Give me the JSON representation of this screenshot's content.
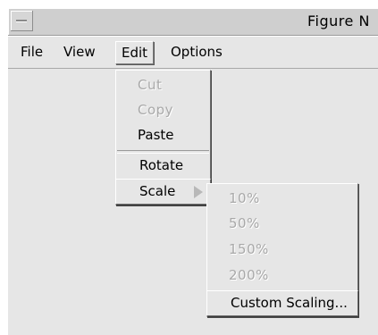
{
  "window": {
    "title": "Figure N"
  },
  "menubar": {
    "items": [
      {
        "label": "File"
      },
      {
        "label": "View"
      },
      {
        "label": "Edit"
      },
      {
        "label": "Options"
      }
    ]
  },
  "edit_menu": {
    "cut": "Cut",
    "copy": "Copy",
    "paste": "Paste",
    "rotate": "Rotate",
    "scale": "Scale"
  },
  "scale_submenu": {
    "items": [
      "10%",
      "50%",
      "150%",
      "200%"
    ],
    "custom": "Custom Scaling..."
  },
  "colors": {
    "background": "#e6e6e6",
    "disabled_text": "#a9a9a9",
    "highlight_border": "#ffffff"
  }
}
